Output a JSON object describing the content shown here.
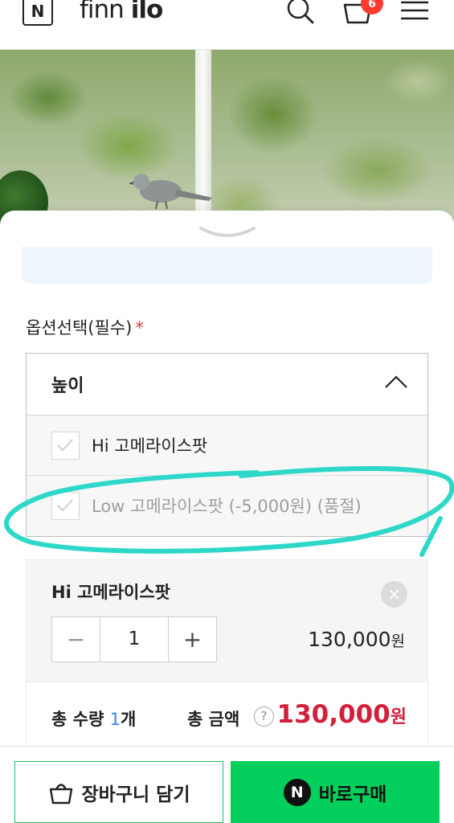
{
  "header": {
    "logo_letter": "N",
    "brand_light": "finn ",
    "brand_bold": "ilo",
    "cart_count": "6"
  },
  "options": {
    "title": "옵션선택(필수)",
    "required_mark": "*",
    "group_label": "높이",
    "items": [
      {
        "label": "Hi 고메라이스팟",
        "sold_out": false
      },
      {
        "label": "Low 고메라이스팟 (-5,000원) (품절)",
        "sold_out": true
      }
    ]
  },
  "selected": {
    "name": "Hi 고메라이스팟",
    "remove_glyph": "×",
    "minus_glyph": "−",
    "plus_glyph": "+",
    "quantity": "1",
    "price": "130,000",
    "price_unit": "원"
  },
  "total": {
    "qty_label": "총 수량 ",
    "qty_value": "1",
    "qty_unit": "개",
    "amount_label": "총 금액",
    "help_glyph": "?",
    "amount": "130,000",
    "amount_unit": "원"
  },
  "actions": {
    "cart_label": "장바구니 담기",
    "buy_icon_letter": "N",
    "buy_label": "바로구매"
  },
  "colors": {
    "accent_green": "#03cf5d",
    "price_red": "#d41f3a",
    "badge_red": "#ff3b30",
    "annotation": "#2ed8c8"
  }
}
